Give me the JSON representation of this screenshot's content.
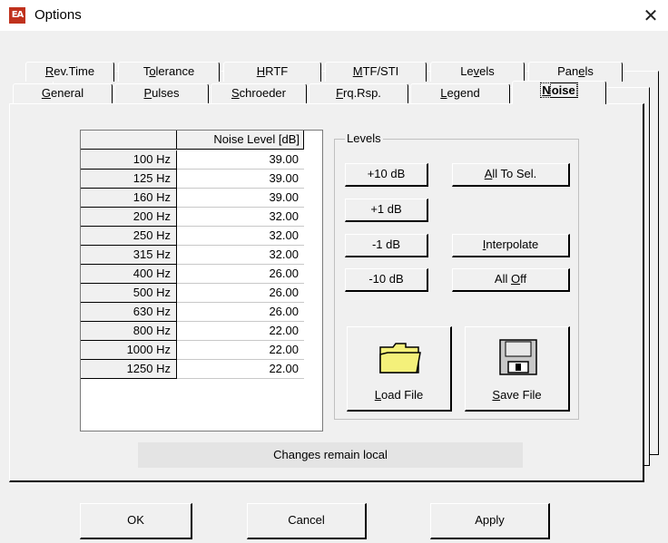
{
  "window": {
    "title": "Options",
    "close_glyph": "✕",
    "app_icon_text": "EA"
  },
  "tabs_row1": [
    {
      "pre": "",
      "u": "R",
      "post": "ev.Time"
    },
    {
      "pre": "T",
      "u": "o",
      "post": "lerance"
    },
    {
      "pre": "",
      "u": "H",
      "post": "RTF"
    },
    {
      "pre": "",
      "u": "M",
      "post": "TF/STI"
    },
    {
      "pre": "Le",
      "u": "v",
      "post": "els"
    },
    {
      "pre": "Pan",
      "u": "e",
      "post": "ls"
    }
  ],
  "tabs_row2": [
    {
      "pre": "",
      "u": "G",
      "post": "eneral"
    },
    {
      "pre": "",
      "u": "P",
      "post": "ulses"
    },
    {
      "pre": "",
      "u": "S",
      "post": "chroeder"
    },
    {
      "pre": "",
      "u": "F",
      "post": "rq.Rsp."
    },
    {
      "pre": "",
      "u": "L",
      "post": "egend"
    },
    {
      "pre": "",
      "u": "N",
      "post": "oise"
    }
  ],
  "grid": {
    "column_header": "Noise Level [dB]",
    "rows": [
      {
        "freq": "100 Hz",
        "level": "39.00"
      },
      {
        "freq": "125 Hz",
        "level": "39.00"
      },
      {
        "freq": "160 Hz",
        "level": "39.00"
      },
      {
        "freq": "200 Hz",
        "level": "32.00"
      },
      {
        "freq": "250 Hz",
        "level": "32.00"
      },
      {
        "freq": "315 Hz",
        "level": "32.00"
      },
      {
        "freq": "400 Hz",
        "level": "26.00"
      },
      {
        "freq": "500 Hz",
        "level": "26.00"
      },
      {
        "freq": "630 Hz",
        "level": "26.00"
      },
      {
        "freq": "800 Hz",
        "level": "22.00"
      },
      {
        "freq": "1000 Hz",
        "level": "22.00"
      },
      {
        "freq": "1250 Hz",
        "level": "22.00"
      }
    ],
    "scroll_up_glyph": "˄",
    "scroll_down_glyph": "˅"
  },
  "levels": {
    "legend": "Levels",
    "plus10": "+10 dB",
    "plus1": "+1 dB",
    "minus1": "-1 dB",
    "minus10": "-10 dB",
    "all_to_sel": {
      "pre": "",
      "u": "A",
      "post": "ll To Sel."
    },
    "interpolate": {
      "pre": "",
      "u": "I",
      "post": "nterpolate"
    },
    "all_off": {
      "pre": "All ",
      "u": "O",
      "post": "ff"
    },
    "load_file": {
      "pre": "",
      "u": "L",
      "post": "oad File"
    },
    "save_file": {
      "pre": "",
      "u": "S",
      "post": "ave File"
    }
  },
  "status": "Changes remain local",
  "buttons": {
    "ok": "OK",
    "cancel": "Cancel",
    "apply": "Apply"
  },
  "colors": {
    "folder_fill": "#f4f07a",
    "icon_red": "#c0321d"
  }
}
